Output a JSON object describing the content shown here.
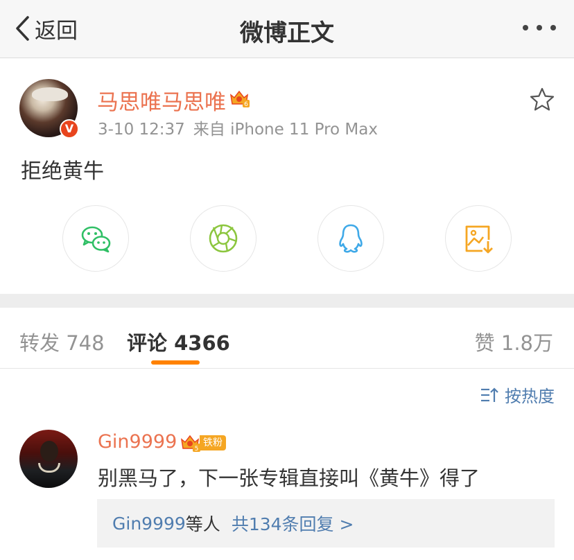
{
  "header": {
    "back_label": "返回",
    "title": "微博正文"
  },
  "post": {
    "author": "马思唯马思唯",
    "time": "3-10 12:37",
    "source": "来自 iPhone 11 Pro Max",
    "text": "拒绝黄牛",
    "verified_badge": "V"
  },
  "share_buttons": [
    {
      "name": "wechat",
      "icon": "wechat-icon",
      "color": "#2fbf65"
    },
    {
      "name": "moments",
      "icon": "moments-icon",
      "color": "#8cc63f"
    },
    {
      "name": "qq",
      "icon": "qq-icon",
      "color": "#3fa9e8"
    },
    {
      "name": "save-image",
      "icon": "save-image-icon",
      "color": "#f5a623"
    }
  ],
  "tabs": {
    "repost": "转发 748",
    "comment": "评论 4366",
    "like": "赞 1.8万"
  },
  "sort_label": "按热度",
  "comment": {
    "author": "Gin9999",
    "level": "5",
    "fan_tag": "铁粉",
    "text": "别黑马了，下一张专辑直接叫《黄牛》得了",
    "reply_user": "Gin9999",
    "reply_mid": "等人",
    "reply_count": "共134条回复 >"
  },
  "colors": {
    "accent": "#ff8200",
    "name": "#eb7350",
    "link": "#507daf"
  }
}
